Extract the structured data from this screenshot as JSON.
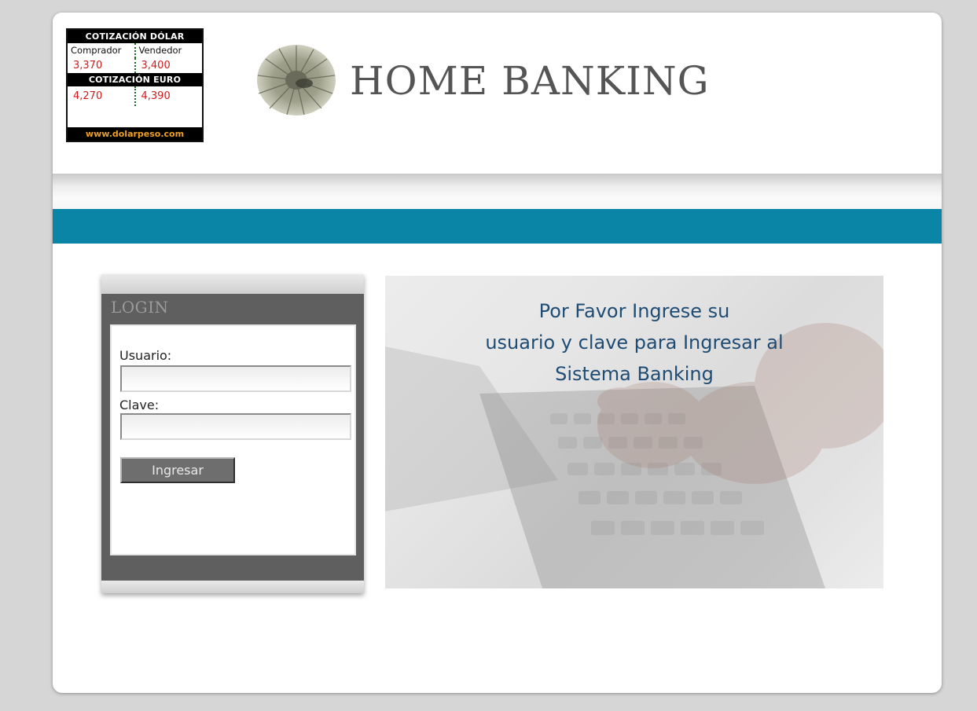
{
  "widget": {
    "dollar_title": "COTIZACIÓN DÓLAR",
    "buyer_label": "Comprador",
    "seller_label": "Vendedor",
    "dollar_buy": "3,370",
    "dollar_sell": "3,400",
    "euro_title": "COTIZACIÓN EURO",
    "euro_buy": "4,270",
    "euro_sell": "4,390",
    "site": "www.dolarpeso.com"
  },
  "header": {
    "brand": "HOME BANKING"
  },
  "login": {
    "title": "LOGIN",
    "usuario_label": "Usuario:",
    "usuario_value": "",
    "clave_label": "Clave:",
    "clave_value": "",
    "submit_label": "Ingresar"
  },
  "hero": {
    "line1": "Por Favor Ingrese su",
    "line2": "usuario y clave para Ingresar al",
    "line3": "Sistema Banking"
  },
  "colors": {
    "teal_band": "#0a85a6",
    "hero_text": "#1e4c74",
    "price_red": "#d11a1a",
    "site_orange": "#f0a020"
  }
}
